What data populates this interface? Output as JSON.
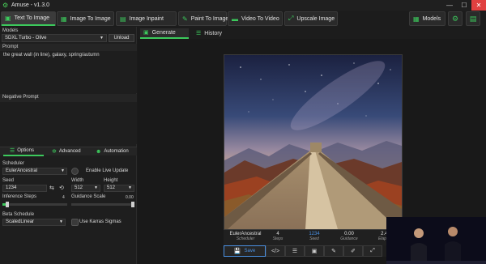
{
  "window": {
    "title": "Amuse - v1.3.0",
    "controls": [
      "minimize",
      "maximize",
      "close"
    ]
  },
  "toolbar": {
    "tabs": [
      {
        "label": "Text To Image",
        "icon": "text-image-icon",
        "active": true
      },
      {
        "label": "Image To Image",
        "icon": "image-image-icon",
        "active": false
      },
      {
        "label": "Image Inpaint",
        "icon": "inpaint-icon",
        "active": false
      },
      {
        "label": "Paint To Image",
        "icon": "paint-icon",
        "active": false
      },
      {
        "label": "Video To Video",
        "icon": "video-icon",
        "active": false
      },
      {
        "label": "Upscale Image",
        "icon": "upscale-icon",
        "active": false
      }
    ],
    "models_label": "Models",
    "accent": "#3cc95c"
  },
  "left": {
    "models_label": "Models",
    "model_value": "SDXL Turbo - Olive",
    "unload_label": "Unload",
    "prompt_label": "Prompt",
    "prompt_text": "the great wall (in line), galaxy, spring/autumn",
    "negative_label": "Negative Prompt",
    "tabs": {
      "options": "Options",
      "advanced": "Advanced",
      "automation": "Automation"
    },
    "scheduler_label": "Scheduler",
    "scheduler_value": "EulerAncestral",
    "live_update_label": "Enable Live Update",
    "seed_label": "Seed",
    "seed_value": "1234",
    "width_label": "Width",
    "width_value": "512",
    "height_label": "Height",
    "height_value": "512",
    "steps_label": "Inference Steps",
    "steps_value": "4",
    "steps_fraction": 0.08,
    "guidance_label": "Guidance Scale",
    "guidance_value": "0.00",
    "beta_label": "Beta Schedule",
    "beta_value": "ScaledLinear",
    "karras_label": "Use Karras Sigmas"
  },
  "main": {
    "tabs": [
      {
        "label": "Generate",
        "active": true
      },
      {
        "label": "History",
        "active": false
      }
    ],
    "info": [
      {
        "value": "EulerAncestral",
        "label": "Scheduler"
      },
      {
        "value": "4",
        "label": "Steps"
      },
      {
        "value": "1234",
        "label": "Seed"
      },
      {
        "value": "0.00",
        "label": "Guidance"
      },
      {
        "value": "2.40",
        "label": "Elapsed"
      }
    ],
    "save_label": "Save"
  }
}
